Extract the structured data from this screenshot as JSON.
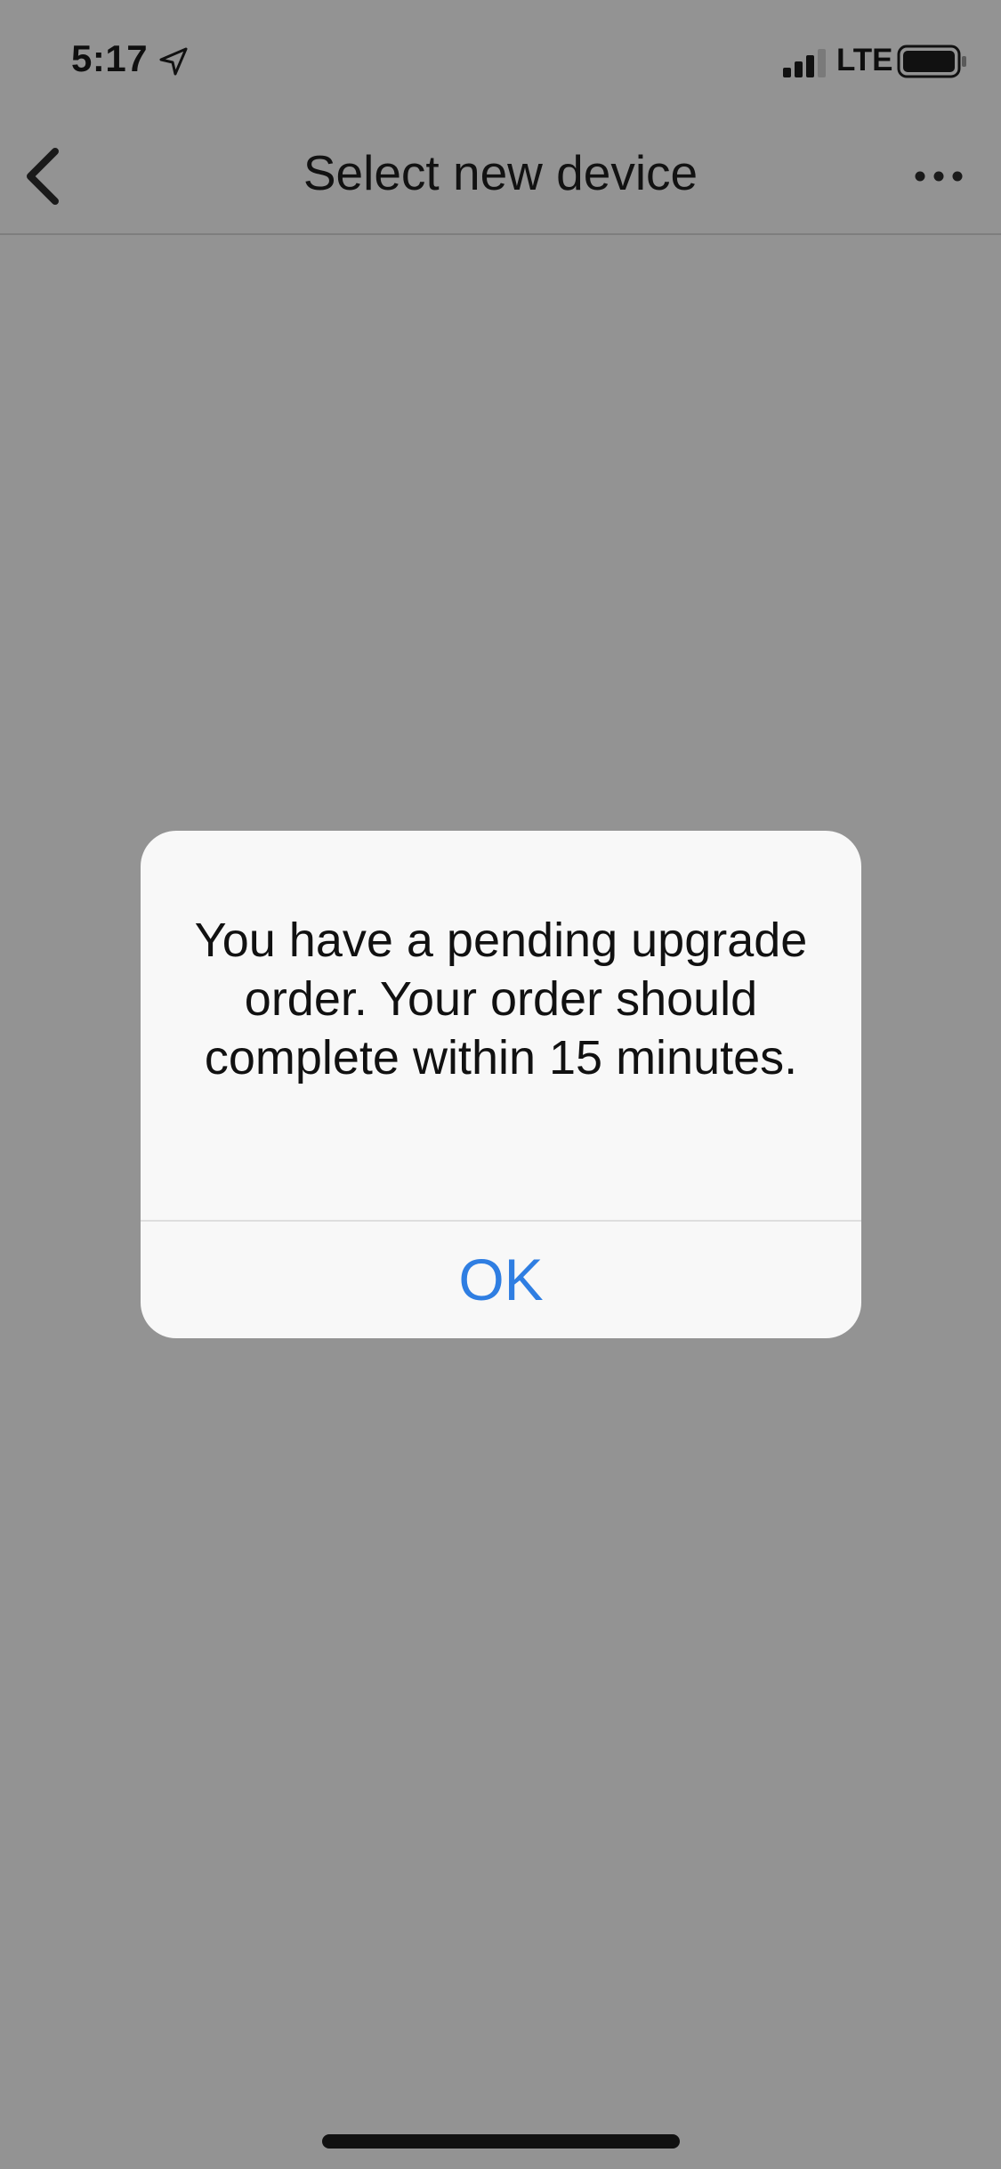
{
  "status_bar": {
    "time": "5:17",
    "network": "LTE",
    "location_icon": "location-arrow-icon",
    "signal_icon": "cellular-signal-icon",
    "battery_icon": "battery-icon"
  },
  "nav": {
    "title": "Select new device",
    "back_icon": "chevron-left-icon",
    "more_icon": "more-horizontal-icon"
  },
  "alert": {
    "message": "You have a pending upgrade order.  Your order should complete within 15 minutes.",
    "ok_label": "OK",
    "ok_color": "#2f7ee2"
  },
  "colors": {
    "overlay_background": "#939393",
    "dialog_background": "#f8f8f8"
  }
}
